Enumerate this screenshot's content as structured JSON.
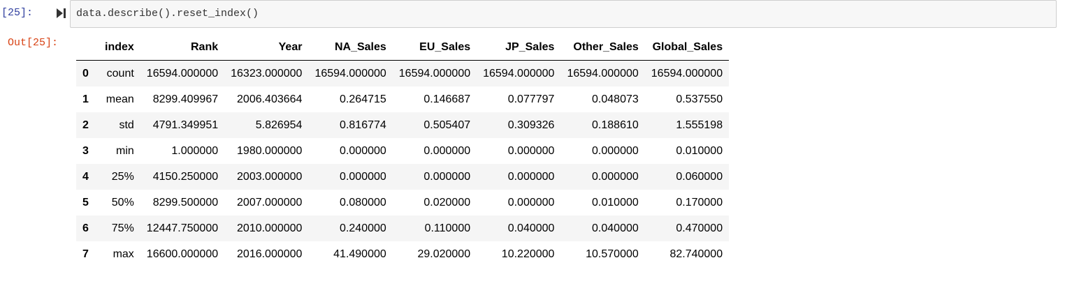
{
  "cell": {
    "in_prompt": "[25]:",
    "out_prompt": "Out[25]:",
    "code": "data.describe().reset_index()"
  },
  "run_icon": "run-cell-icon",
  "table": {
    "columns": [
      "index",
      "Rank",
      "Year",
      "NA_Sales",
      "EU_Sales",
      "JP_Sales",
      "Other_Sales",
      "Global_Sales"
    ],
    "rows": [
      {
        "idx": "0",
        "cells": [
          "count",
          "16594.000000",
          "16323.000000",
          "16594.000000",
          "16594.000000",
          "16594.000000",
          "16594.000000",
          "16594.000000"
        ]
      },
      {
        "idx": "1",
        "cells": [
          "mean",
          "8299.409967",
          "2006.403664",
          "0.264715",
          "0.146687",
          "0.077797",
          "0.048073",
          "0.537550"
        ]
      },
      {
        "idx": "2",
        "cells": [
          "std",
          "4791.349951",
          "5.826954",
          "0.816774",
          "0.505407",
          "0.309326",
          "0.188610",
          "1.555198"
        ]
      },
      {
        "idx": "3",
        "cells": [
          "min",
          "1.000000",
          "1980.000000",
          "0.000000",
          "0.000000",
          "0.000000",
          "0.000000",
          "0.010000"
        ]
      },
      {
        "idx": "4",
        "cells": [
          "25%",
          "4150.250000",
          "2003.000000",
          "0.000000",
          "0.000000",
          "0.000000",
          "0.000000",
          "0.060000"
        ]
      },
      {
        "idx": "5",
        "cells": [
          "50%",
          "8299.500000",
          "2007.000000",
          "0.080000",
          "0.020000",
          "0.000000",
          "0.010000",
          "0.170000"
        ]
      },
      {
        "idx": "6",
        "cells": [
          "75%",
          "12447.750000",
          "2010.000000",
          "0.240000",
          "0.110000",
          "0.040000",
          "0.040000",
          "0.470000"
        ]
      },
      {
        "idx": "7",
        "cells": [
          "max",
          "16600.000000",
          "2016.000000",
          "41.490000",
          "29.020000",
          "10.220000",
          "10.570000",
          "82.740000"
        ]
      }
    ]
  }
}
